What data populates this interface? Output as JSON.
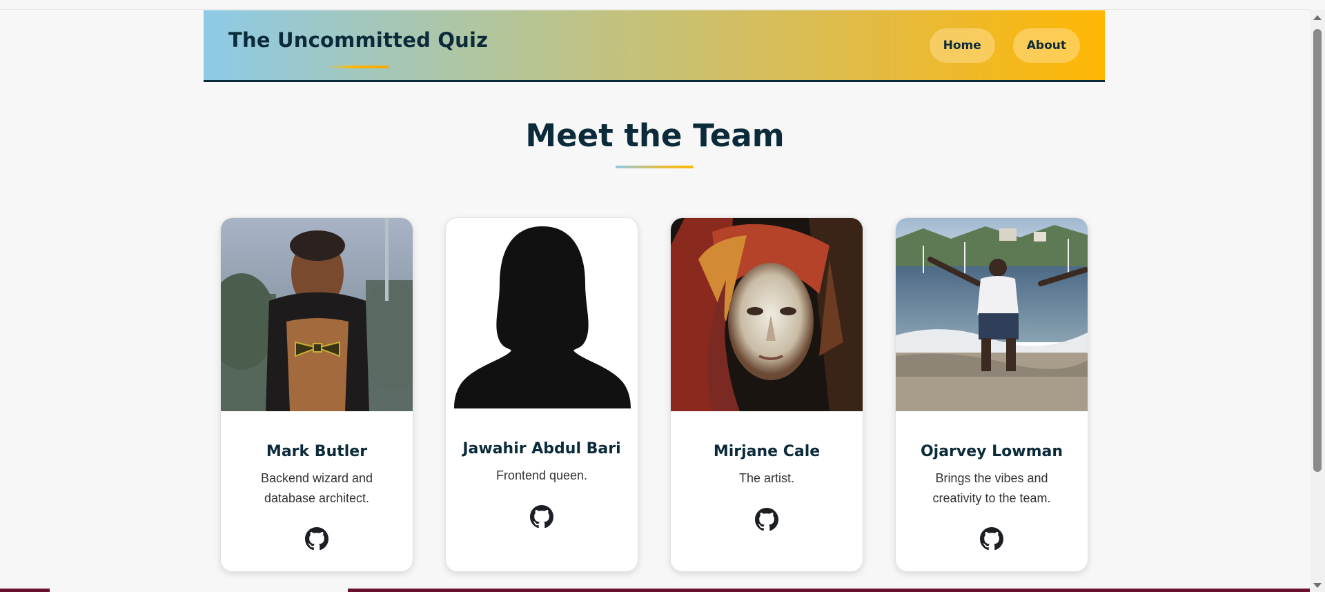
{
  "header": {
    "title": "The Uncommitted Quiz",
    "nav": [
      {
        "label": "Home"
      },
      {
        "label": "About"
      }
    ],
    "colors": {
      "gradient_start": "#8ecae6",
      "gradient_end": "#ffb703",
      "text": "#0b2a3a"
    }
  },
  "section": {
    "title": "Meet the Team"
  },
  "team": [
    {
      "name": "Mark Butler",
      "description": "Backend wizard and database architect.",
      "photo": "wooden-bird-figure-photo",
      "link_icon": "github-icon"
    },
    {
      "name": "Jawahir Abdul Bari",
      "description": "Frontend queen.",
      "photo": "female-silhouette-placeholder",
      "link_icon": "github-icon"
    },
    {
      "name": "Mirjane Cale",
      "description": "The artist.",
      "photo": "painted-portrait-artwork",
      "link_icon": "github-icon"
    },
    {
      "name": "Ojarvey Lowman",
      "description": "Brings the vibes and creativity to the team.",
      "photo": "beach-harbor-photo",
      "link_icon": "github-icon"
    }
  ]
}
